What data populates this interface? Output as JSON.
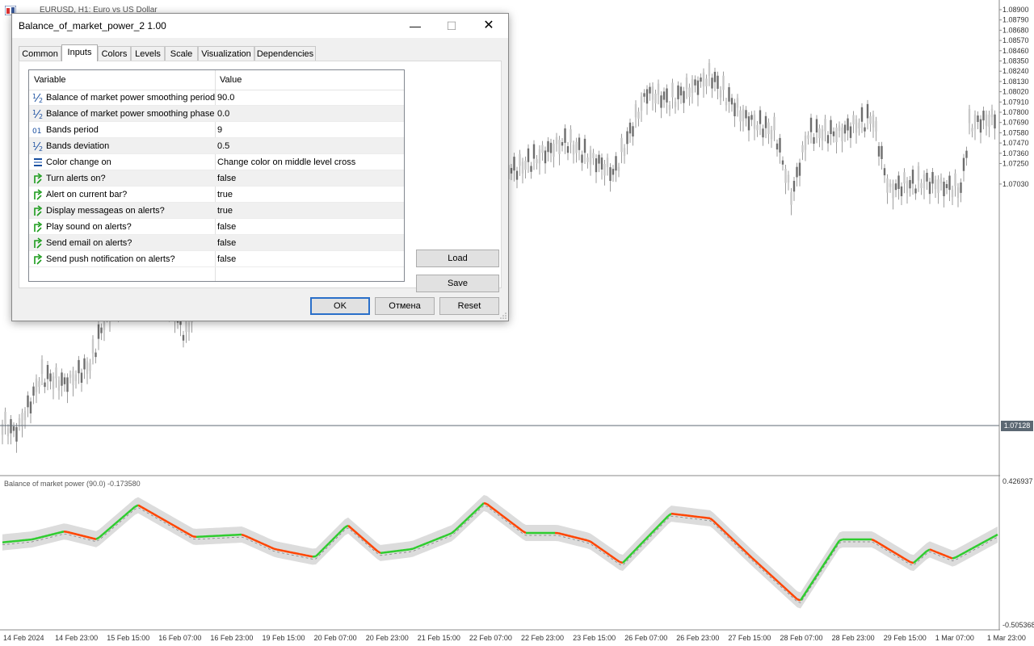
{
  "window": {
    "chart_title": "EURUSD, H1:  Euro vs US Dollar",
    "indicator_label": "Balance of market power (90.0) -0.173580",
    "current_price": "1.07128"
  },
  "price_axis": [
    "1.08900",
    "1.08790",
    "1.08680",
    "1.08570",
    "1.08460",
    "1.08350",
    "1.08240",
    "1.08130",
    "1.08020",
    "1.07910",
    "1.07800",
    "1.07690",
    "1.07580",
    "1.07470",
    "1.07360",
    "1.07250",
    "1.07030"
  ],
  "indicator_axis": {
    "top": "0.426937",
    "bottom": "-0.505368"
  },
  "time_axis": [
    "14 Feb 2024",
    "14 Feb 23:00",
    "15 Feb 15:00",
    "16 Feb 07:00",
    "16 Feb 23:00",
    "19 Feb 15:00",
    "20 Feb 07:00",
    "20 Feb 23:00",
    "21 Feb 15:00",
    "22 Feb 07:00",
    "22 Feb 23:00",
    "23 Feb 15:00",
    "26 Feb 07:00",
    "26 Feb 23:00",
    "27 Feb 15:00",
    "28 Feb 07:00",
    "28 Feb 23:00",
    "29 Feb 15:00",
    "1 Mar 07:00",
    "1 Mar 23:00"
  ],
  "colors": {
    "up": "#2ecc2e",
    "down": "#ff4400",
    "band": "#dcdcdc",
    "candle": "#9e9e9e",
    "ok_border": "#2a6fc9"
  },
  "dialog": {
    "title": "Balance_of_market_power_2 1.00",
    "controls": {
      "minimize": "—",
      "maximize": "☐",
      "close": "✕"
    },
    "tabs": [
      "Common",
      "Inputs",
      "Colors",
      "Levels",
      "Scale",
      "Visualization",
      "Dependencies"
    ],
    "active_tab": "Inputs",
    "table": {
      "headers": {
        "variable": "Variable",
        "value": "Value"
      },
      "rows": [
        {
          "icon": "fraction-icon",
          "name": "Balance of market power smoothing period",
          "value": "90.0"
        },
        {
          "icon": "fraction-icon",
          "name": "Balance of market power smoothing phase",
          "value": "0.0"
        },
        {
          "icon": "integer-icon",
          "name": "Bands period",
          "value": "9"
        },
        {
          "icon": "fraction-icon",
          "name": "Bands deviation",
          "value": "0.5"
        },
        {
          "icon": "enum-icon",
          "name": "Color change on",
          "value": "Change color on middle level cross"
        },
        {
          "icon": "bool-icon",
          "name": "Turn alerts on?",
          "value": "false"
        },
        {
          "icon": "bool-icon",
          "name": "Alert on current bar?",
          "value": "true"
        },
        {
          "icon": "bool-icon",
          "name": "Display messageas on alerts?",
          "value": "true"
        },
        {
          "icon": "bool-icon",
          "name": "Play sound on alerts?",
          "value": "false"
        },
        {
          "icon": "bool-icon",
          "name": "Send email on alerts?",
          "value": "false"
        },
        {
          "icon": "bool-icon",
          "name": "Send push notification on alerts?",
          "value": "false"
        }
      ]
    },
    "buttons": {
      "load": "Load",
      "save": "Save",
      "ok": "OK",
      "cancel": "Отмена",
      "reset": "Reset"
    }
  }
}
